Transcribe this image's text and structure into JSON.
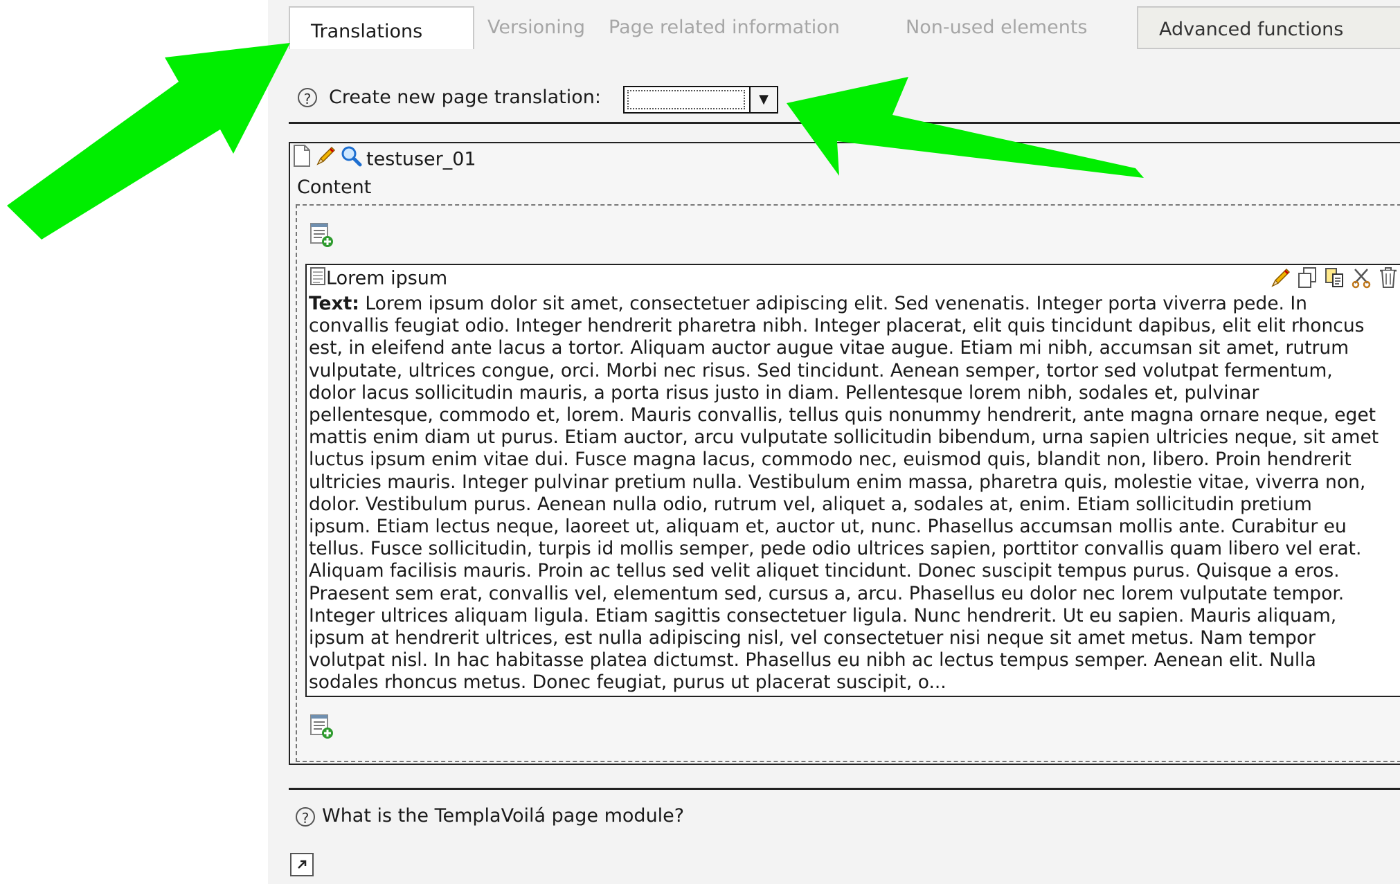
{
  "tabs": {
    "translations": "Translations",
    "versioning": "Versioning",
    "page_related": "Page related information",
    "non_used": "Non-used elements",
    "advanced": "Advanced functions"
  },
  "create": {
    "help": "?",
    "label": "Create new page translation:",
    "select_value": ""
  },
  "page": {
    "title": "testuser_01",
    "content_label": "Content"
  },
  "content_element": {
    "title": "Lorem ipsum",
    "text_prefix": "Text:",
    "text_lines": [
      " Lorem ipsum dolor sit amet, consectetuer adipiscing elit. Sed venenatis. Integer porta viverra pede. In",
      "convallis feugiat odio. Integer hendrerit pharetra nibh. Integer placerat, elit quis tincidunt dapibus, elit elit rhoncus",
      "est, in eleifend ante lacus a tortor. Aliquam auctor augue vitae augue. Etiam mi nibh, accumsan sit amet, rutrum",
      "vulputate, ultrices congue, orci. Morbi nec risus. Sed tincidunt. Aenean semper, tortor sed volutpat fermentum,",
      "dolor lacus sollicitudin mauris, a porta risus justo in diam. Pellentesque lorem nibh, sodales et, pulvinar",
      "pellentesque, commodo et, lorem. Mauris convallis, tellus quis nonummy hendrerit, ante magna ornare neque, eget",
      "mattis enim diam ut purus. Etiam auctor, arcu vulputate sollicitudin bibendum, urna sapien ultricies neque, sit amet",
      "luctus ipsum enim vitae dui. Fusce magna lacus, commodo nec, euismod quis, blandit non, libero. Proin hendrerit",
      "ultricies mauris. Integer pulvinar pretium nulla. Vestibulum enim massa, pharetra quis, molestie vitae, viverra non,",
      "dolor. Vestibulum purus. Aenean nulla odio, rutrum vel, aliquet a, sodales at, enim. Etiam sollicitudin pretium",
      "ipsum. Etiam lectus neque, laoreet ut, aliquam et, auctor ut, nunc. Phasellus accumsan mollis ante. Curabitur eu",
      "tellus. Fusce sollicitudin, turpis id mollis semper, pede odio ultrices sapien, porttitor convallis quam libero vel erat.",
      "Aliquam facilisis mauris. Proin ac tellus sed velit aliquet tincidunt. Donec suscipit tempus purus. Quisque a eros.",
      "Praesent sem erat, convallis vel, elementum sed, cursus a, arcu. Phasellus eu dolor nec lorem vulputate tempor.",
      "Integer ultrices aliquam ligula. Etiam sagittis consectetuer ligula. Nunc hendrerit. Ut eu sapien. Mauris aliquam,",
      "ipsum at hendrerit ultrices, est nulla adipiscing nisl, vel consectetuer nisi neque sit amet metus. Nam tempor",
      "volutpat nisl. In hac habitasse platea dictumst. Phasellus eu nibh ac lectus tempus semper. Aenean elit. Nulla",
      "sodales rhoncus metus. Donec feugiat, purus ut placerat suscipit, o..."
    ]
  },
  "help_link": "What is the TemplaVoilá page module?",
  "colors": {
    "annotation_arrow": "#00ee00",
    "panel_bg": "#f3f3f3"
  },
  "icons": [
    "help-icon",
    "dropdown-arrow-icon",
    "page-icon",
    "pencil-icon",
    "magnifier-icon",
    "add-content-icon",
    "document-icon",
    "copy-icon",
    "cut-icon",
    "trash-icon",
    "shortcut-icon"
  ]
}
